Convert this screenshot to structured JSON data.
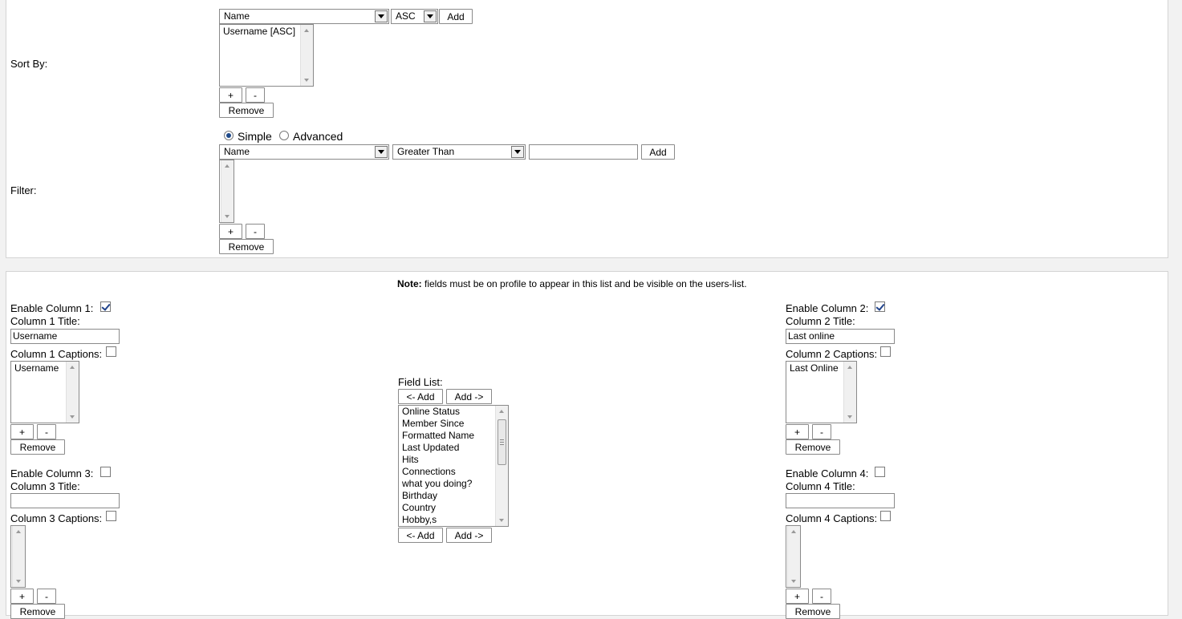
{
  "sort": {
    "label": "Sort By:",
    "field_select": "Name",
    "direction_select": "ASC",
    "add_label": "Add",
    "items": [
      "Username [ASC]"
    ],
    "plus_label": "+",
    "minus_label": "-",
    "remove_label": "Remove"
  },
  "filter": {
    "label": "Filter:",
    "mode_simple": "Simple",
    "mode_advanced": "Advanced",
    "field_select": "Name",
    "operator_select": "Greater Than",
    "value": "",
    "add_label": "Add",
    "plus_label": "+",
    "minus_label": "-",
    "remove_label": "Remove"
  },
  "note": {
    "bold": "Note:",
    "text": " fields must be on profile to appear in this list and be visible on the users-list."
  },
  "columns": {
    "col1": {
      "enable_label": "Enable Column 1:",
      "enabled": true,
      "title_label": "Column 1 Title:",
      "title_value": "Username",
      "captions_label": "Column 1 Captions:",
      "items": [
        "Username"
      ],
      "plus_label": "+",
      "minus_label": "-",
      "remove_label": "Remove"
    },
    "col2": {
      "enable_label": "Enable Column 2:",
      "enabled": true,
      "title_label": "Column 2 Title:",
      "title_value": "Last online",
      "captions_label": "Column 2 Captions:",
      "items": [
        "Last Online"
      ],
      "plus_label": "+",
      "minus_label": "-",
      "remove_label": "Remove"
    },
    "col3": {
      "enable_label": "Enable Column 3:",
      "enabled": false,
      "title_label": "Column 3 Title:",
      "title_value": "",
      "captions_label": "Column 3 Captions:",
      "items": [],
      "plus_label": "+",
      "minus_label": "-",
      "remove_label": "Remove"
    },
    "col4": {
      "enable_label": "Enable Column 4:",
      "enabled": false,
      "title_label": "Column 4 Title:",
      "title_value": "",
      "captions_label": "Column 4 Captions:",
      "items": [],
      "plus_label": "+",
      "minus_label": "-",
      "remove_label": "Remove"
    }
  },
  "field_list": {
    "label": "Field List:",
    "add_left_label": "<- Add",
    "add_right_label": "Add ->",
    "items": [
      "Online Status",
      "Member Since",
      "Formatted Name",
      "Last Updated",
      "Hits",
      "Connections",
      "what you doing?",
      "Birthday",
      "Country",
      "Hobby,s"
    ]
  }
}
